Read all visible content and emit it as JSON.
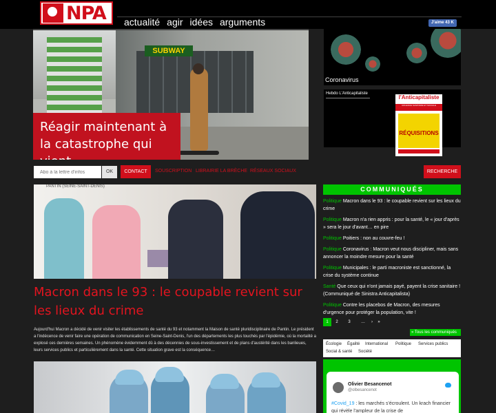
{
  "header": {
    "logo_text": "NPA",
    "nav": [
      "actualité",
      "agir",
      "idées",
      "arguments"
    ],
    "fb_like": "J'aime 43 K"
  },
  "hero": {
    "sign_text": "SUBWAY",
    "caption": "Réagir maintenant à la catastrophe qui vient"
  },
  "side": {
    "corona_label": "Coronavirus",
    "hebdo_label": "Hebdo L'Anticapitaliste",
    "journal": {
      "title": "l'Anticapitaliste",
      "band": "URGENCE SANITAIRE ET SOCIALE",
      "headline": "RÉQUISITIONS"
    }
  },
  "search": {
    "placeholder": "Abo à la lettre d'infos",
    "ok_label": "OK",
    "contact_label": "CONTACT",
    "links": [
      "SOUSCRIPTION",
      "LIBRAIRIE LA BRÈCHE",
      "RÉSEAUX SOCIAUX"
    ],
    "search_label": "RECHERCHE"
  },
  "article": {
    "location": "PANTIN (SEINE-SAINT-DENIS)",
    "title": "Macron dans le 93 : le coupable revient sur les lieux du crime",
    "body": "Aujourd'hui Macron a décidé de venir visiter les établissements de santé du 93 et notamment la Maison de santé pluridisciplinaire de Pantin. Le président a l'indécence de venir faire une opération de communication en Seine-Saint-Denis, l'un des départements les plus touchés par l'épidémie, où la mortalité a explosé ces dernières semaines. Un phénomène évidemment dû à des décennies de sous-investissement et de plans d'austérité dans les banlieues, leurs services publics et particulièrement dans la santé. Cette situation grave est la conséquence…"
  },
  "communiques": {
    "heading": "COMMUNIQUÉS",
    "items": [
      {
        "cat": "Politique",
        "text": "Macron dans le 93 : le coupable revient sur les lieux du crime"
      },
      {
        "cat": "Politique",
        "text": "Macron n'a rien appris : pour la santé, le « jour d'après » sera le jour d'avant… en pire"
      },
      {
        "cat": "Politique",
        "text": "Poitiers : non au couvre-feu !"
      },
      {
        "cat": "Politique",
        "text": "Coronavirus : Macron veut nous discipliner, mais sans annoncer la moindre mesure pour la santé"
      },
      {
        "cat": "Politique",
        "text": "Municipales : le parti macroniste est sanctionné, la crise du système continue"
      },
      {
        "cat": "Santé",
        "text": "Que ceux qui n'ont jamais payé, payent la crise sanitaire ! (Communiqué de Sinistra Anticapitalista)"
      },
      {
        "cat": "Politique",
        "text": "Contre les placebos de Macron, des mesures d'urgence pour protéger la population, vite !"
      }
    ],
    "pages": [
      "1",
      "2",
      "3",
      "…",
      "›",
      "»"
    ],
    "all_label": "» Tous les communiqués"
  },
  "tags": [
    "Écologie",
    "Égalité",
    "International",
    "Politique",
    "Services publics",
    "Social & santé",
    "Société"
  ],
  "tweet": {
    "name": "Olivier Besancenot",
    "handle": "@olbesancenot",
    "hashtag": "#Covid_19",
    "text": " : les marchés s'écroulent. Un krach financier qui révèle l'ampleur de la crise de"
  },
  "colors": {
    "brand_red": "#d10f1b",
    "accent_green": "#00c400",
    "background": "#1e1e1e"
  }
}
